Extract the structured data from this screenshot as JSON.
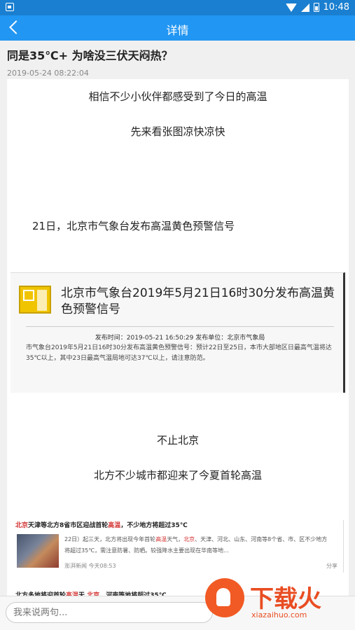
{
  "status": {
    "time": "10:48"
  },
  "header": {
    "title": "详情"
  },
  "article": {
    "title": "同是35℃+ 为啥没三伏天闷热？",
    "time": "2019-05-24 08:22:04",
    "paragraphs": [
      "相信不少小伙伴都感受到了今日的高温",
      "先来看张图凉快凉快",
      "21日，北京市气象台发布高温黄色预警信号",
      "不止北京",
      "北方不少城市都迎来了今夏首轮高温"
    ],
    "alert": {
      "headline": "北京市气象台2019年5月21日16时30分发布高温黄色预警信号",
      "meta": "发布时间：2019-05-21 16:50:29 发布单位：北京市气象局",
      "body": "市气象台2019年5月21日16时30分发布高温黄色预警信号：预计22日至25日，本市大部地区日最高气温将达35℃以上，其中23日最高气温局地可达37℃以上，请注意防范。"
    },
    "news": [
      {
        "title_red1": "北京",
        "title_mid": "天津等北方8省市区迎战首轮",
        "title_red2": "高温",
        "title_end": "，不少地方将超过35℃",
        "text_a": "22日）起三天，北方将出现今年首轮",
        "text_red1": "高温",
        "text_b": "天气，",
        "text_red2": "北京",
        "text_c": "、天津、河北、山东、河南等8个省、市、区不少地方将超过35℃，需注意防暑、防晒。较强降水主要出现在华南等地...",
        "source": "澎湃新闻   今天08:53",
        "share": "分享"
      },
      {
        "title_a": "北方多地将迎首轮",
        "title_red1": "高温",
        "title_b": "天 ",
        "title_red2": "北京",
        "title_c": "、河南等地将超过35℃"
      }
    ]
  },
  "comment": {
    "placeholder": "我来说两句..."
  },
  "watermark": {
    "brand": "下载火",
    "domain": "xiazaihuo.com"
  }
}
